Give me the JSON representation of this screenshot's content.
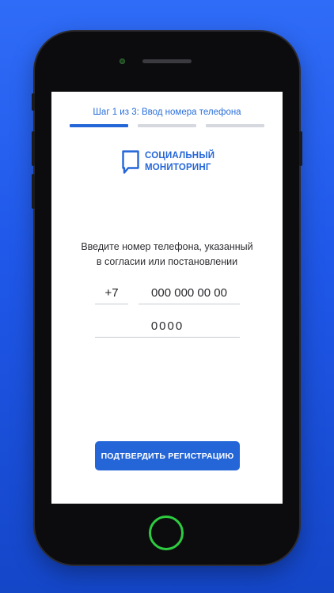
{
  "header": {
    "step_text": "Шаг 1 из 3: Ввод номера телефона",
    "steps": {
      "current": 1,
      "total": 3
    }
  },
  "logo": {
    "line1": "СОЦИАЛЬНЫЙ",
    "line2": "МОНИТОРИНГ",
    "icon": "speech-bubble-icon"
  },
  "instruction": {
    "line1": "Введите номер телефона, указанный",
    "line2": "в согласии или постановлении"
  },
  "form": {
    "country_code": "+7",
    "phone_placeholder": "000 000 00 00",
    "code_placeholder": "0000"
  },
  "actions": {
    "confirm_label": "ПОДТВЕРДИТЬ РЕГИСТРАЦИЮ"
  },
  "colors": {
    "accent": "#2466d8",
    "background_top": "#2f6cf7",
    "background_bottom": "#1446c8",
    "progress_inactive": "#d5d8df"
  }
}
